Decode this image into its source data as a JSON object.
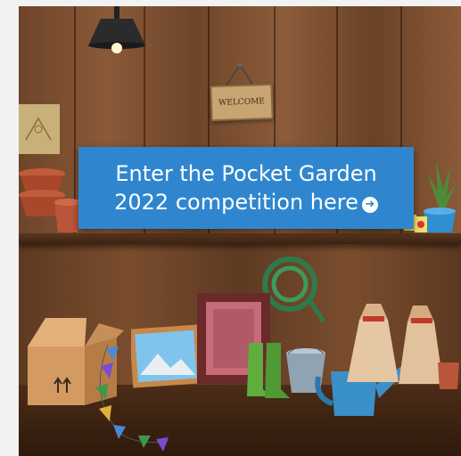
{
  "banner": {
    "line1": "Enter the Pocket Garden",
    "line2": "2022 competition here",
    "arrow_icon": "arrow-right-circle-icon",
    "color": "#2f86cf"
  },
  "sign": {
    "text": "WELCOME"
  },
  "colors": {
    "wood_light": "#8a5a38",
    "wood_dark": "#6e4428",
    "shelf": "#4a2c17"
  }
}
